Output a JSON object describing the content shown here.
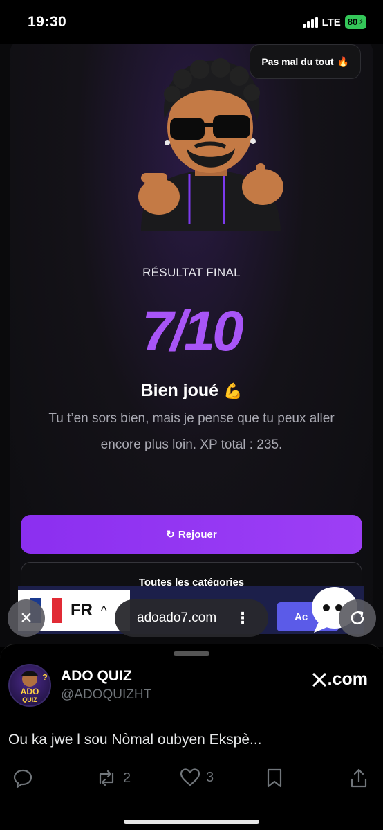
{
  "status_bar": {
    "time": "19:30",
    "network": "LTE",
    "battery": "80"
  },
  "toast": {
    "text": "Pas mal du tout",
    "icon": "fire-icon"
  },
  "result": {
    "label": "RÉSULTAT FINAL",
    "score": "7/10",
    "headline": "Bien joué",
    "headline_emoji": "💪",
    "description": "Tu t’en sors bien, mais je pense que tu peux aller encore plus loin. XP total : 235."
  },
  "buttons": {
    "replay": "Rejouer",
    "all_categories": "Toutes les catégories"
  },
  "language_banner": {
    "code": "FR",
    "accept_label": "Ac"
  },
  "browser": {
    "url": "adoado7.com"
  },
  "tweet": {
    "name": "ADO QUIZ",
    "handle": "@ADOQUIZHT",
    "domain": ".com",
    "text": "Ou ka jwe l sou Nòmal oubyen Ekspè...",
    "retweets": "2",
    "likes": "3",
    "avatar_text_top": "ADO",
    "avatar_text_bottom": "QUIZ"
  },
  "colors": {
    "accent": "#a855f7",
    "button": "#8b2ff0",
    "background": "#0d0d10",
    "battery": "#34c759"
  }
}
